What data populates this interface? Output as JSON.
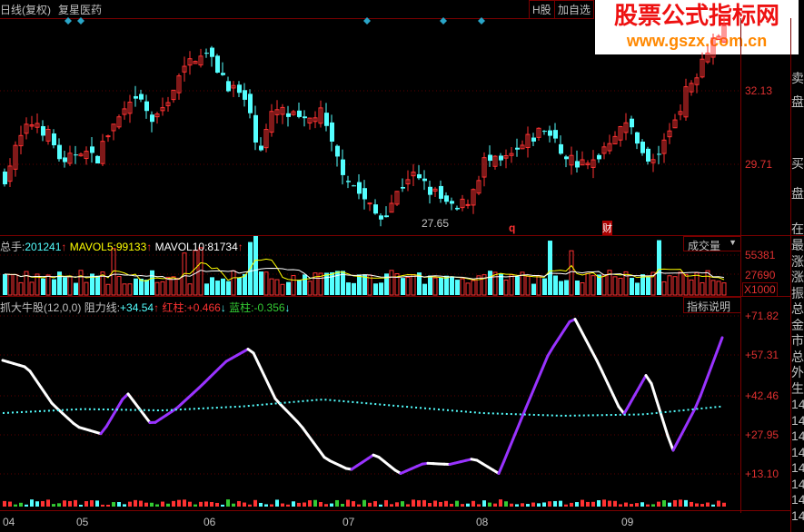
{
  "header": {
    "period_label": "日线(复权)",
    "stock_name": "复星医药",
    "h_share_button": "H股",
    "add_watch_button": "加自选",
    "watermark_line1": "股票公式指标网",
    "watermark_line2": "www.gszx.com.cn"
  },
  "price_panel": {
    "ticks": [
      "32.13",
      "29.71"
    ],
    "low_label": "27.65",
    "event_markers": [
      "q",
      "财"
    ],
    "right_labels": [
      "卖",
      "盘",
      "买",
      "盘",
      "在"
    ]
  },
  "volume_panel": {
    "total_label": "总手:",
    "total_value": "201241",
    "mavol5_label": "MAVOL5:",
    "mavol5_value": "99133",
    "mavol10_label": "MAVOL10:",
    "mavol10_value": "81734",
    "selector": "成交量",
    "ticks": [
      "55381",
      "27690"
    ],
    "unit": "X1000"
  },
  "indicator_panel": {
    "name": "抓大牛股(12,0,0)",
    "resistance_label": "阻力线:",
    "resistance_value": "+34.54",
    "red_label": "红柱:",
    "red_value": "+0.466",
    "blue_label": "蓝柱:",
    "blue_value": "-0.356",
    "help_button": "指标说明",
    "ticks": [
      "+71.82",
      "+57.31",
      "+42.46",
      "+27.95",
      "+13.10"
    ],
    "right_labels": [
      "最",
      "涨",
      "涨",
      "振",
      "总",
      "金",
      "市",
      "总",
      "外",
      "生",
      "14",
      "14",
      "14",
      "14",
      "14",
      "14",
      "14",
      "14"
    ]
  },
  "date_axis": [
    "04",
    "05",
    "06",
    "07",
    "08",
    "09"
  ],
  "colors": {
    "up": "#ff3232",
    "down": "#54ffff",
    "rise_line": "#9933ff",
    "fall_line": "#ffffff",
    "mavol5": "#ffff00",
    "mavol10": "#ffffff",
    "grid": "#7a0000"
  },
  "chart_data": {
    "type": "candlestick",
    "price_path": [
      29.3,
      30.5,
      31.2,
      30.6,
      29.6,
      30.3,
      29.8,
      30.8,
      31.4,
      31.8,
      31.0,
      32.0,
      32.8,
      33.5,
      33.0,
      32.3,
      31.8,
      30.2,
      31.5,
      31.3,
      31.0,
      31.5,
      30.0,
      29.2,
      28.5,
      27.9,
      28.6,
      29.4,
      29.0,
      28.6,
      28.1,
      28.6,
      29.8,
      29.7,
      30.0,
      30.5,
      30.9,
      30.2,
      29.8,
      29.6,
      30.3,
      31.0,
      30.8,
      29.6,
      30.4,
      31.6,
      32.6,
      33.7,
      34.2
    ],
    "indicator_path": [
      55.2,
      52.5,
      38.9,
      30.4,
      27.7,
      43.3,
      31.1,
      37.2,
      45.7,
      54.8,
      60.0,
      40.6,
      31.1,
      18.5,
      14.1,
      20.2,
      12.8,
      16.8,
      16.3,
      18.5,
      12.9,
      35.5,
      57.6,
      71.8,
      54.2,
      34.5,
      50.8,
      21.2,
      38.9,
      63.7
    ],
    "resistance_level": [
      35.5,
      37.0,
      36.5,
      38.0,
      40.6,
      38.0,
      35.5,
      34.5,
      35.0,
      38.0
    ]
  }
}
